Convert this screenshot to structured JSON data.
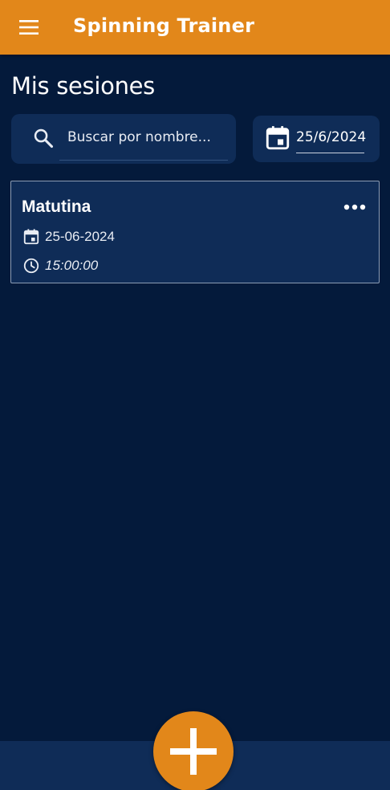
{
  "app_bar": {
    "title": "Spinning Trainer",
    "menu_icon": "hamburger-menu-icon",
    "background_color": "#e2871a"
  },
  "page": {
    "title": "Mis sesiones",
    "background_color": "#041a3b"
  },
  "search": {
    "placeholder": "Buscar por nombre...",
    "value": "",
    "icon": "search-icon"
  },
  "date_filter": {
    "value": "25/6/2024",
    "icon": "calendar-icon"
  },
  "sessions": [
    {
      "name": "Matutina",
      "date": "25-06-2024",
      "time": "15:00:00",
      "date_icon": "calendar-icon",
      "time_icon": "clock-icon",
      "more_icon": "more-options-icon"
    }
  ],
  "fab": {
    "icon": "add-icon",
    "color": "#e2871a"
  }
}
